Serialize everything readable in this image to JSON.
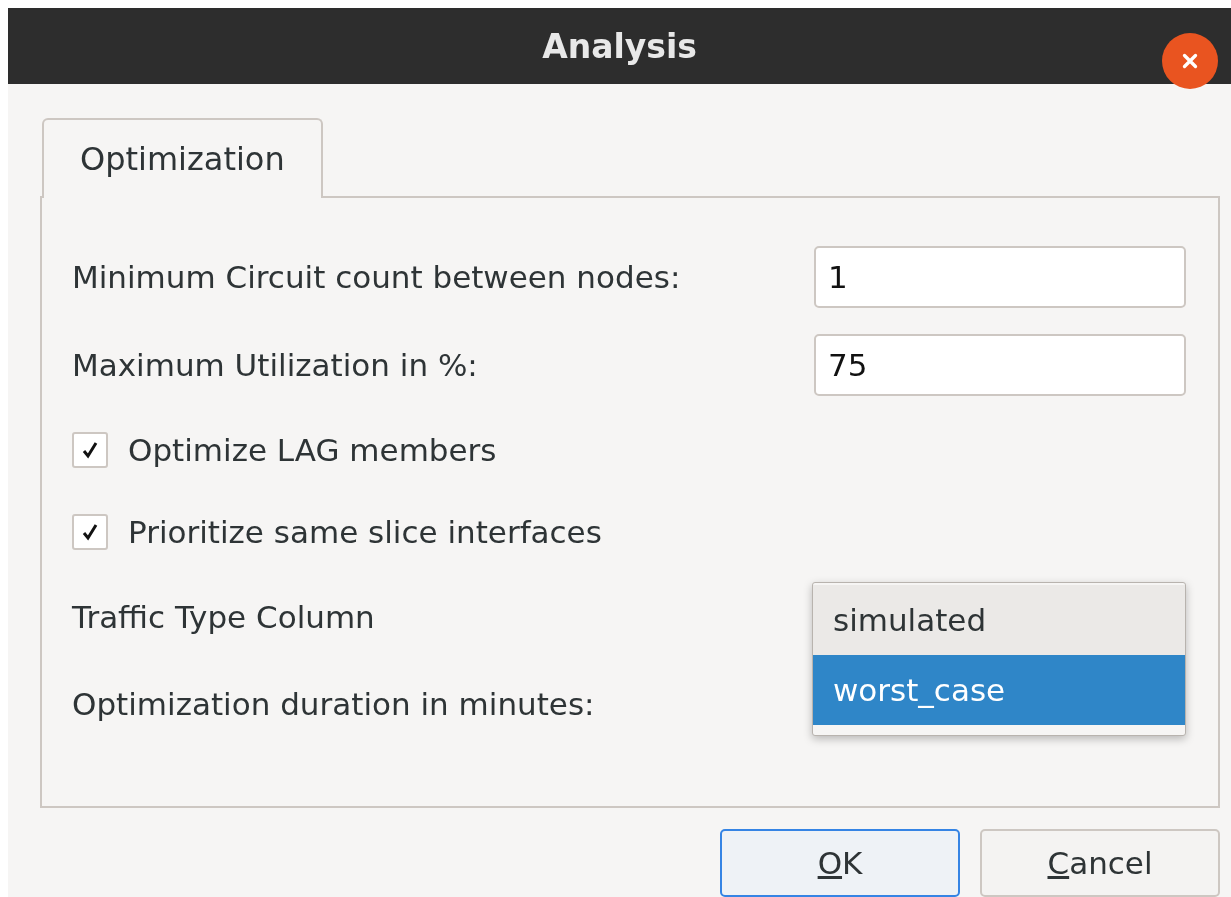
{
  "window": {
    "title": "Analysis"
  },
  "tabs": [
    {
      "label": "Optimization",
      "selected": true
    }
  ],
  "fields": [
    {
      "label": "Minimum Circuit count between nodes:",
      "value": "1"
    },
    {
      "label": "Maximum Utilization in %:",
      "value": "75"
    }
  ],
  "checkboxes": [
    {
      "label": "Optimize LAG members",
      "checked": true
    },
    {
      "label": "Prioritize same slice interfaces",
      "checked": true
    }
  ],
  "traffic_type": {
    "label": "Traffic Type Column",
    "options": [
      {
        "label": "simulated",
        "selected": false
      },
      {
        "label": "worst_case",
        "selected": true
      }
    ]
  },
  "duration": {
    "label": "Optimization duration in minutes:"
  },
  "buttons": [
    {
      "label": "OK",
      "underline_first": true,
      "default": true
    },
    {
      "label": "Cancel",
      "underline_first": true,
      "default": false
    }
  ]
}
